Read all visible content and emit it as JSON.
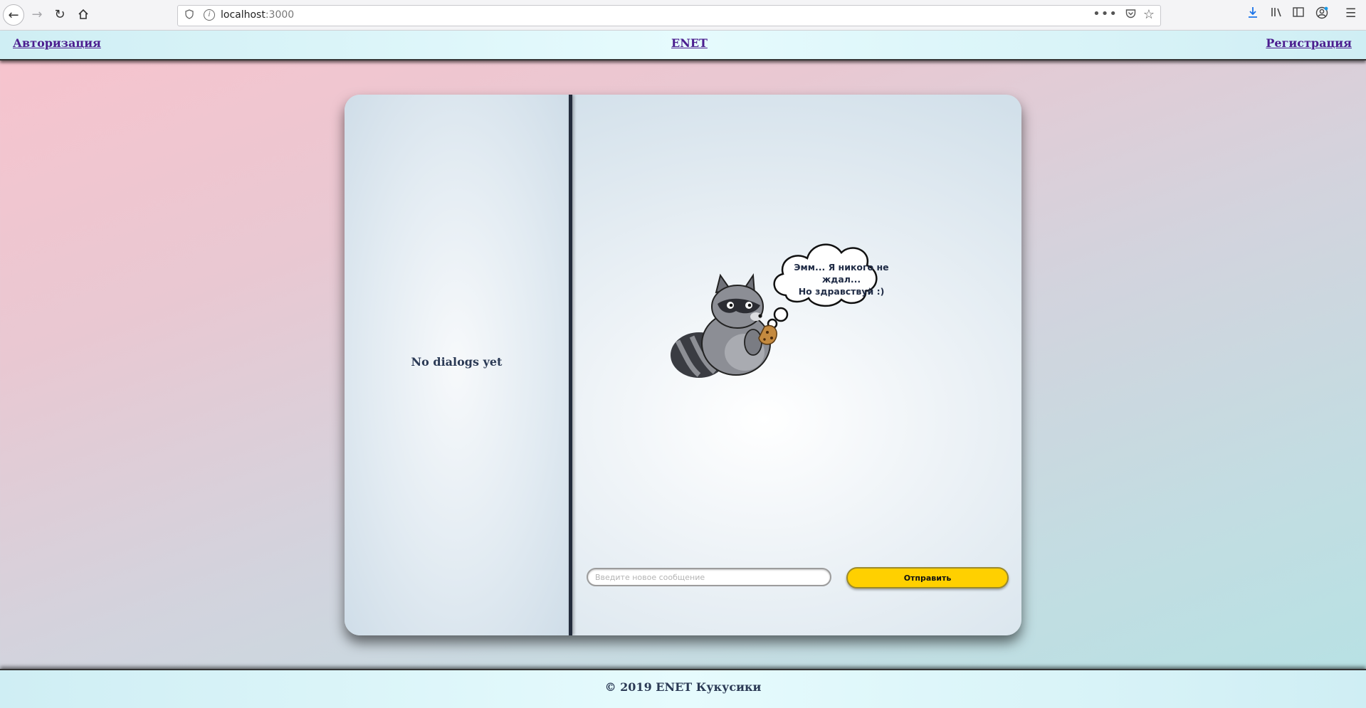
{
  "browser": {
    "url_host": "localhost",
    "url_port": ":3000",
    "more_glyph": "•••"
  },
  "header": {
    "login_link": "Авторизация",
    "brand": "ENET",
    "register_link": "Регистрация"
  },
  "sidebar": {
    "empty_text": "No dialogs yet"
  },
  "chat": {
    "thought_line1": "Эмм... Я никого не ждал...",
    "thought_line2": "Но здравствуй :)",
    "input_placeholder": "Введите новое сообщение",
    "send_label": "Отправить"
  },
  "footer": {
    "copyright": "© 2019 ENET Кукусики"
  },
  "colors": {
    "accent_button": "#ffd000",
    "link": "#4b1d8f",
    "text_dark": "#2b3a55"
  }
}
